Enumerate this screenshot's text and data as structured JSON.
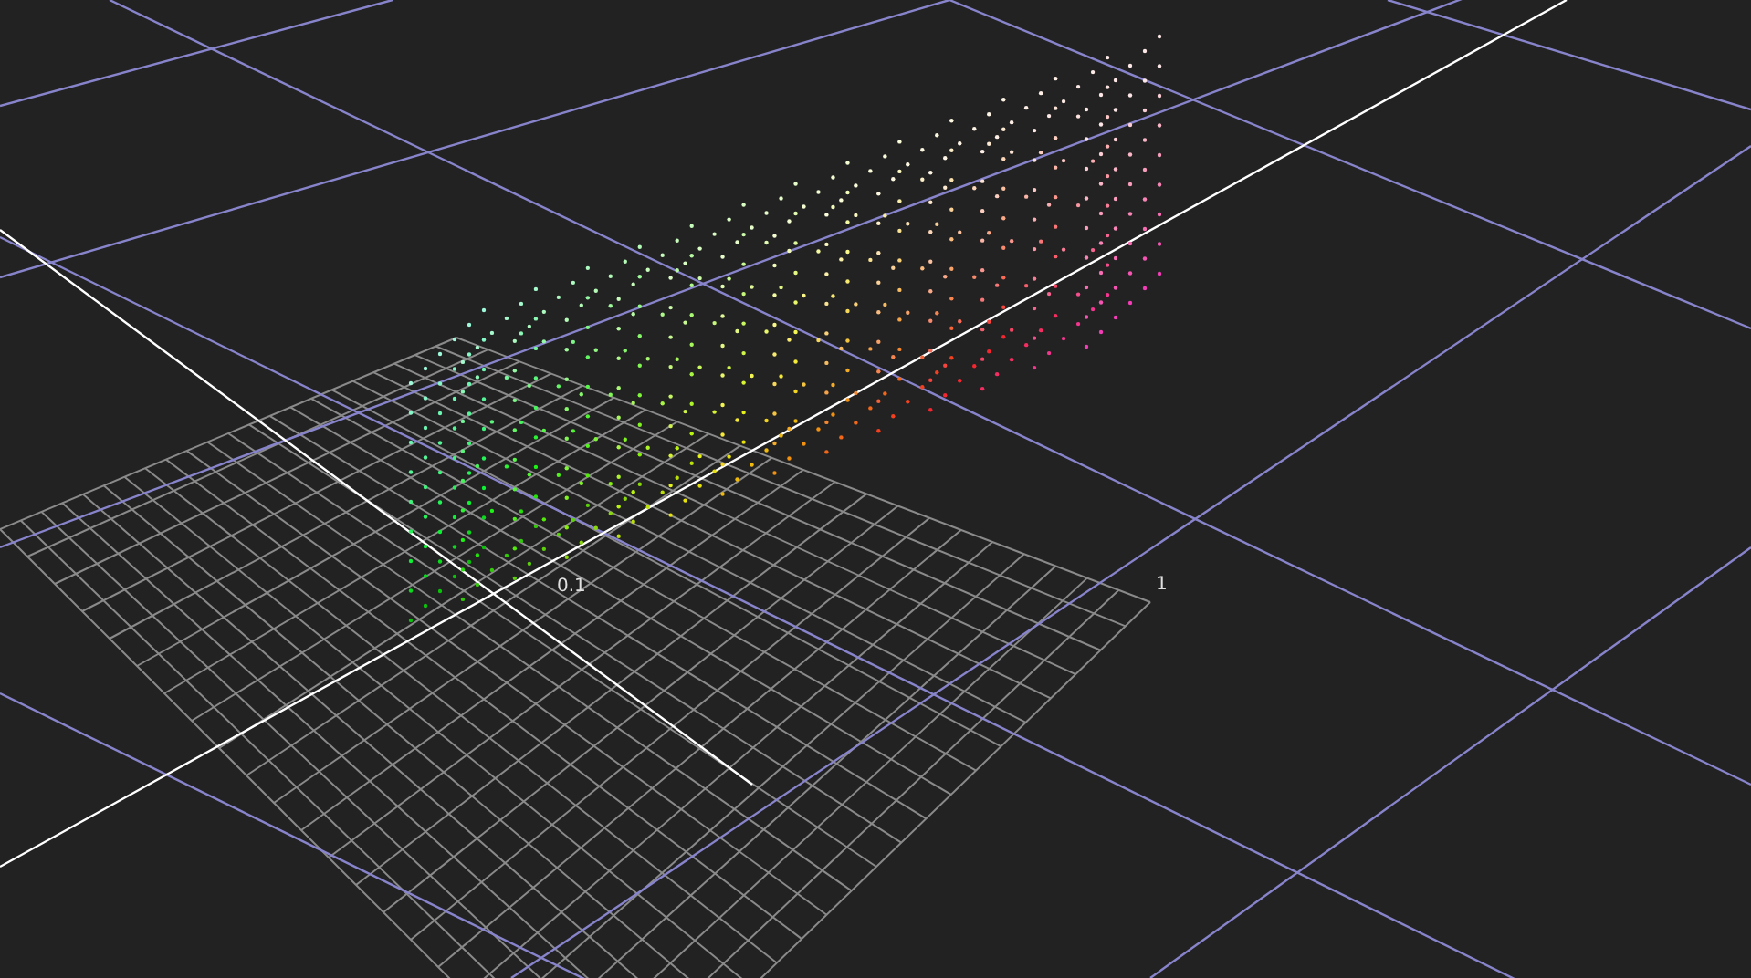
{
  "axis_labels": [
    {
      "text": "0.1"
    },
    {
      "text": "1"
    }
  ]
}
